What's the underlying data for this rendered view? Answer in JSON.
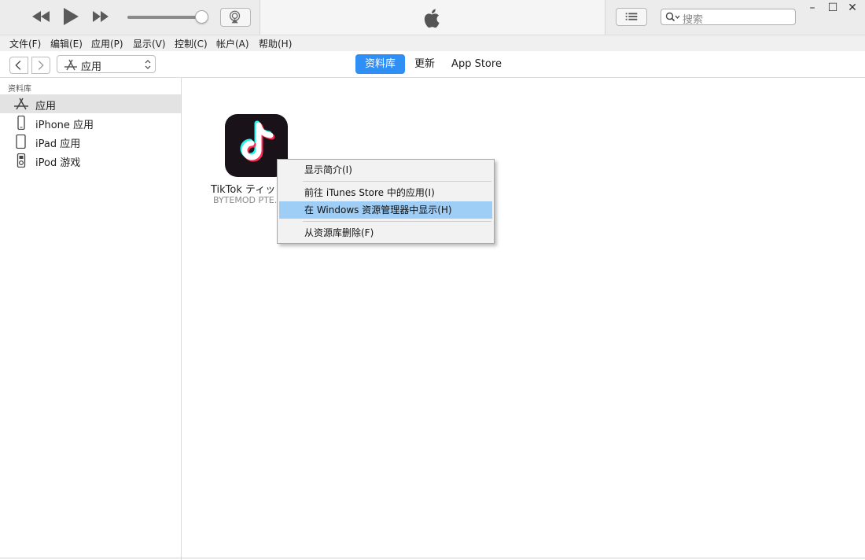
{
  "window": {
    "minimize_glyph": "–",
    "maximize_glyph": "☐",
    "close_glyph": "✕"
  },
  "search": {
    "placeholder": "搜索"
  },
  "menubar": {
    "items": [
      "文件(F)",
      "编辑(E)",
      "应用(P)",
      "显示(V)",
      "控制(C)",
      "帐户(A)",
      "帮助(H)"
    ]
  },
  "navbar": {
    "media_select_label": "应用",
    "tabs": [
      "资料库",
      "更新",
      "App Store"
    ],
    "active_tab": "资料库"
  },
  "sidebar": {
    "heading": "资料库",
    "items": [
      {
        "label": "应用",
        "icon": "app-store-icon",
        "selected": true
      },
      {
        "label": "iPhone 应用",
        "icon": "iphone-icon",
        "selected": false
      },
      {
        "label": "iPad 应用",
        "icon": "ipad-icon",
        "selected": false
      },
      {
        "label": "iPod 游戏",
        "icon": "ipod-icon",
        "selected": false
      }
    ]
  },
  "apps": [
    {
      "name": "TikTok ティッ",
      "developer": "BYTEMOD PTE."
    }
  ],
  "context_menu": {
    "items": [
      {
        "label": "显示简介(I)",
        "highlighted": false
      },
      {
        "label": "前往 iTunes Store 中的应用(I)",
        "highlighted": false
      },
      {
        "label": "在 Windows 资源管理器中显示(H)",
        "highlighted": true
      },
      {
        "label": "从资源库删除(F)",
        "highlighted": false
      }
    ]
  },
  "colors": {
    "accent": "#2f8ff5",
    "menu_highlight": "#9ecdf5",
    "toolbar_bg": "#ececec",
    "tiktok_cyan": "#25f4ee",
    "tiktok_red": "#fe2c55"
  }
}
